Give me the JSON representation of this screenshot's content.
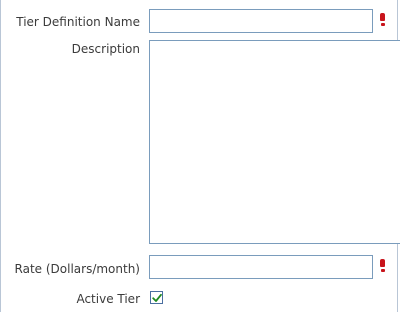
{
  "form": {
    "tier_name": {
      "label": "Tier Definition Name",
      "value": "",
      "required": true
    },
    "description": {
      "label": "Description",
      "value": ""
    },
    "rate": {
      "label": "Rate (Dollars/month)",
      "value": "",
      "required": true
    },
    "active": {
      "label": "Active Tier",
      "checked": true
    }
  },
  "colors": {
    "required_marker": "#c8141c",
    "input_border": "#7a9cbc",
    "check_mark": "#1f8a1f"
  }
}
